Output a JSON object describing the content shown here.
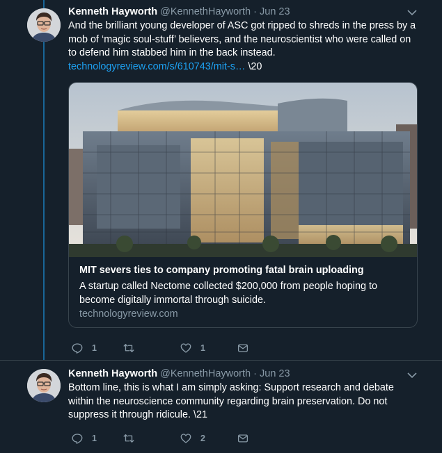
{
  "tweets": [
    {
      "name": "Kenneth Hayworth",
      "handle": "@KennethHayworth",
      "dot": "·",
      "date": "Jun 23",
      "text": "And the brilliant young developer of ASC got ripped to shreds in the press by a mob of ‘magic soul-stuff’ believers, and the neuroscientist who were called on to defend him stabbed him in the back instead.",
      "link": "technologyreview.com/s/610743/mit-s…",
      "suffix": " \\20",
      "card": {
        "title": "MIT severs ties to company promoting fatal brain uploading",
        "description": "A startup called Nectome collected $200,000 from people hoping to become digitally immortal through suicide.",
        "domain": "technologyreview.com"
      },
      "actions": {
        "reply": "1",
        "retweet": "",
        "like": "1"
      }
    },
    {
      "name": "Kenneth Hayworth",
      "handle": "@KennethHayworth",
      "dot": "·",
      "date": "Jun 23",
      "text": "Bottom line, this is what I am simply asking: Support research and debate within the neuroscience community regarding brain preservation. Do not suppress it through ridicule. \\21",
      "actions": {
        "reply": "1",
        "retweet": "",
        "like": "2"
      }
    }
  ],
  "icons": {
    "reply": "reply-icon",
    "retweet": "retweet-icon",
    "like": "heart-icon",
    "dm": "envelope-icon",
    "menu": "chevron-down-icon"
  },
  "colors": {
    "background": "#15202b",
    "accent": "#1da1f2",
    "secondary_text": "#8899a6",
    "border": "#38444d"
  }
}
